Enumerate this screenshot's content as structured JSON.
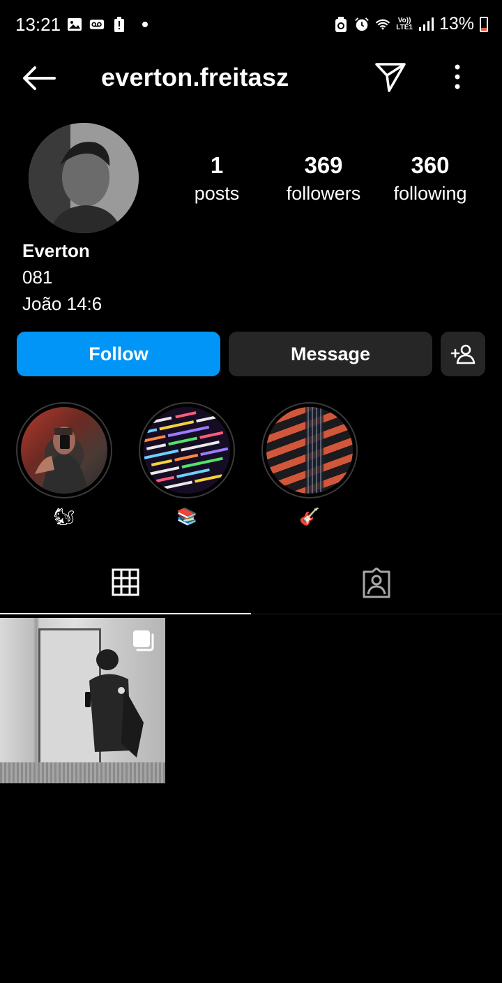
{
  "status_bar": {
    "time": "13:21",
    "network_top": "Vo))",
    "network_bottom": "LTE1",
    "battery": "13%",
    "icons": [
      "image-icon",
      "voicemail-icon",
      "alert-battery-icon",
      "dot-icon",
      "recycle-icon",
      "alarm-icon",
      "wifi-icon",
      "signal-icon",
      "battery-icon"
    ]
  },
  "header": {
    "username": "everton.freitasz",
    "back_icon": "arrow-left-icon",
    "direct_icon": "paper-plane-icon",
    "more_icon": "vertical-dots-icon"
  },
  "profile": {
    "stats": {
      "posts_value": "1",
      "posts_label": "posts",
      "followers_value": "369",
      "followers_label": "followers",
      "following_value": "360",
      "following_label": "following"
    },
    "bio": {
      "name": "Everton",
      "line1": "081",
      "line2": "João 14:6"
    }
  },
  "actions": {
    "follow_label": "Follow",
    "message_label": "Message",
    "add_user_icon": "add-person-icon"
  },
  "highlights": [
    {
      "label": "🐿"
    },
    {
      "label": "📚"
    },
    {
      "label": "🎸"
    }
  ],
  "tabs": {
    "grid_icon": "grid-icon",
    "tagged_icon": "tagged-person-icon"
  },
  "colors": {
    "background": "#000000",
    "follow_button": "#0095f6",
    "secondary_button": "#262626",
    "text": "#ffffff"
  }
}
